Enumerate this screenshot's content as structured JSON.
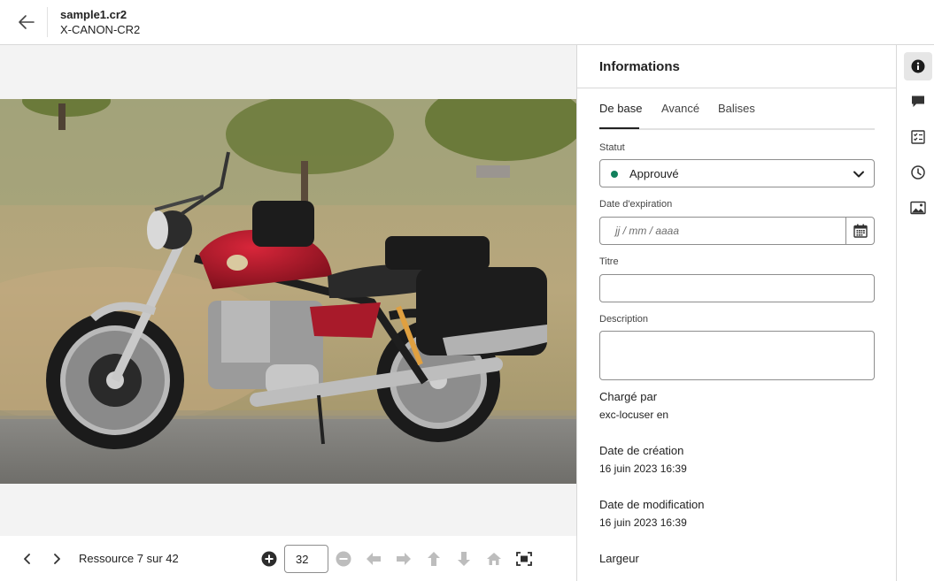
{
  "header": {
    "file_name": "sample1.cr2",
    "file_type": "X-CANON-CR2"
  },
  "toolbar": {
    "resource_label": "Ressource 7 sur 42",
    "zoom_value": "32"
  },
  "panel": {
    "title": "Informations",
    "tabs": [
      {
        "label": "De base",
        "active": true
      },
      {
        "label": "Avancé",
        "active": false
      },
      {
        "label": "Balises",
        "active": false
      }
    ],
    "status": {
      "label": "Statut",
      "value": "Approuvé",
      "color": "#12805c"
    },
    "expiration": {
      "label": "Date d'expiration",
      "placeholder": "jj  / mm / aaaa"
    },
    "title_field": {
      "label": "Titre",
      "value": ""
    },
    "description_field": {
      "label": "Description",
      "value": ""
    },
    "uploaded_by": {
      "label": "Chargé par",
      "value": "exc-locuser en"
    },
    "created": {
      "label": "Date de création",
      "value": "16 juin 2023 16:39"
    },
    "modified": {
      "label": "Date de modification",
      "value": "16 juin 2023 16:39"
    },
    "width": {
      "label": "Largeur"
    }
  },
  "rail": {
    "items": [
      "info-icon",
      "comment-icon",
      "tasks-icon",
      "history-icon",
      "renditions-icon"
    ],
    "active": "info-icon"
  }
}
